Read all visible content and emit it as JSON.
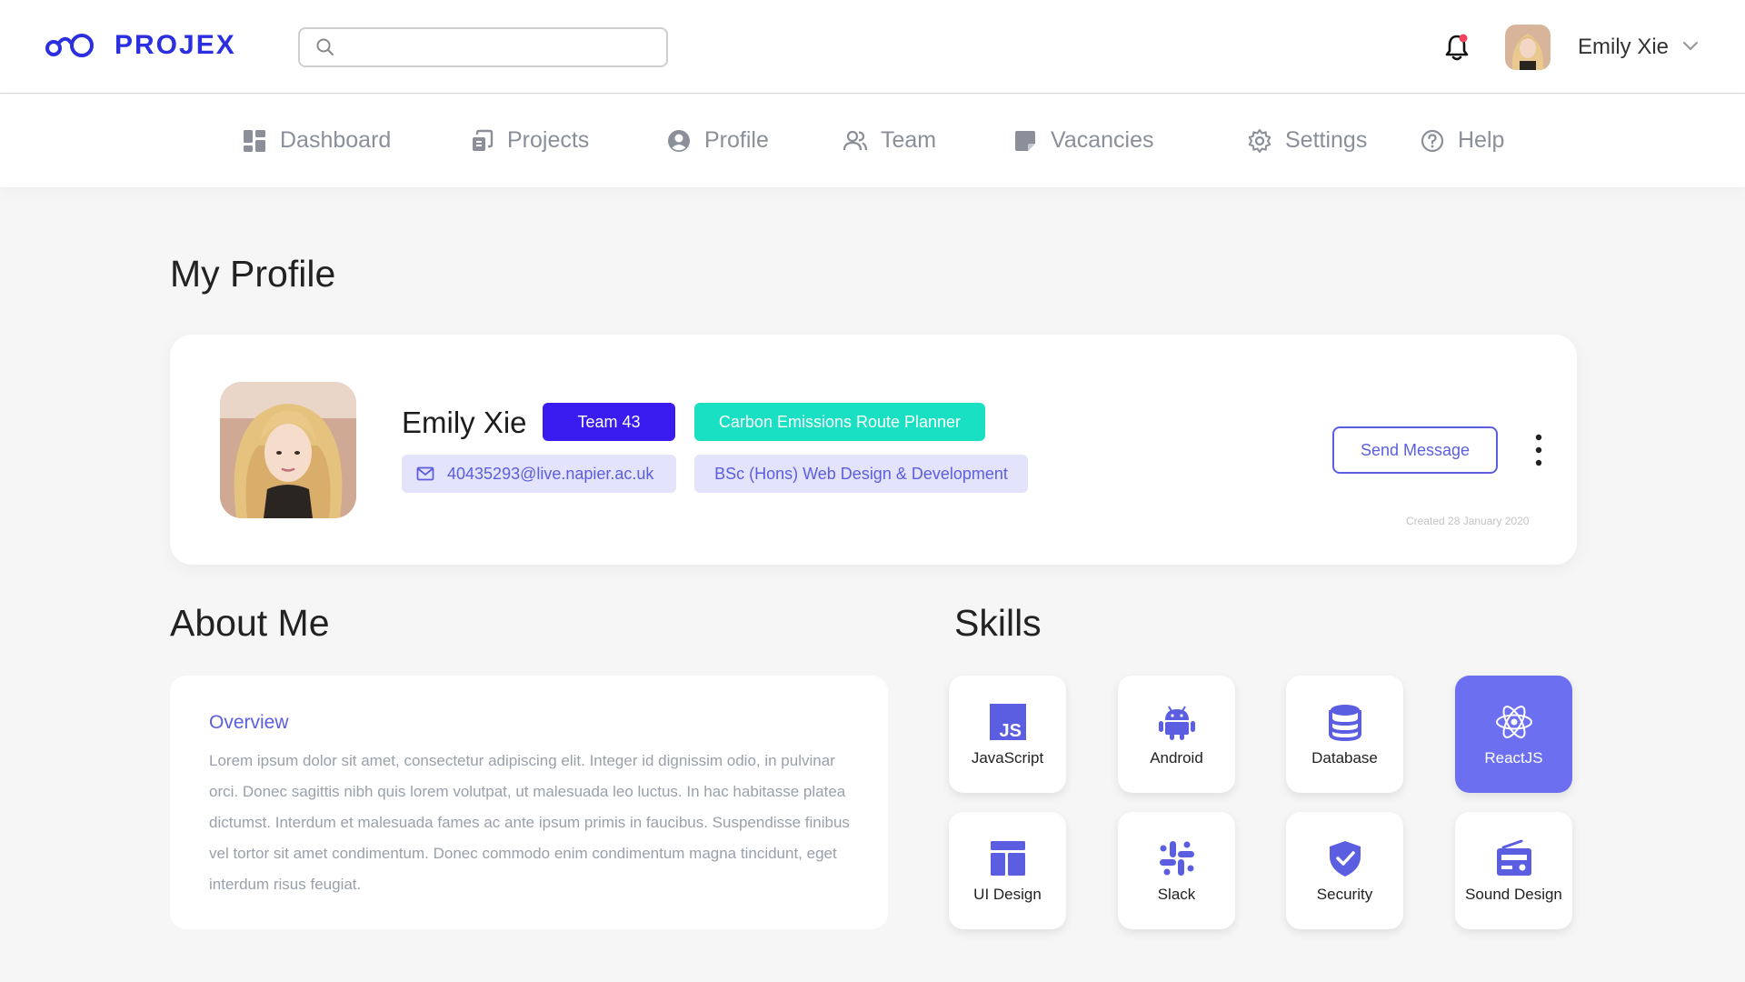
{
  "brand": {
    "name": "PROJEX",
    "color": "#2b2fe0"
  },
  "search": {
    "placeholder": "",
    "icon": "search-icon"
  },
  "user": {
    "name": "Emily Xie",
    "has_notification": true
  },
  "nav": {
    "items": [
      {
        "label": "Dashboard",
        "icon": "dashboard-icon"
      },
      {
        "label": "Projects",
        "icon": "projects-icon"
      },
      {
        "label": "Profile",
        "icon": "profile-icon"
      },
      {
        "label": "Team",
        "icon": "team-icon"
      },
      {
        "label": "Vacancies",
        "icon": "vacancies-icon"
      },
      {
        "label": "Settings",
        "icon": "settings-icon"
      },
      {
        "label": "Help",
        "icon": "help-icon"
      }
    ]
  },
  "page": {
    "title": "My Profile"
  },
  "profile": {
    "name": "Emily Xie",
    "team": "Team 43",
    "project": "Carbon Emissions Route Planner",
    "email": "40435293@live.napier.ac.uk",
    "degree": "BSc (Hons) Web Design & Development",
    "send_message": "Send Message",
    "created": "Created 28 January 2020"
  },
  "about": {
    "heading": "About Me",
    "title": "Overview",
    "text": "Lorem ipsum dolor sit amet, consectetur adipiscing elit. Integer id dignissim odio, in pulvinar orci. Donec sagittis nibh quis lorem volutpat, ut malesuada leo luctus. In hac habitasse platea dictumst. Interdum et malesuada fames ac ante ipsum primis in faucibus. Suspendisse finibus vel tortor sit amet condimentum. Donec commodo enim condimentum magna tincidunt, eget interdum risus feugiat."
  },
  "skills": {
    "heading": "Skills",
    "items": [
      {
        "label": "JavaScript",
        "icon": "javascript-icon",
        "active": false
      },
      {
        "label": "Android",
        "icon": "android-icon",
        "active": false
      },
      {
        "label": "Database",
        "icon": "database-icon",
        "active": false
      },
      {
        "label": "ReactJS",
        "icon": "react-icon",
        "active": true
      },
      {
        "label": "UI Design",
        "icon": "ui-design-icon",
        "active": false
      },
      {
        "label": "Slack",
        "icon": "slack-icon",
        "active": false
      },
      {
        "label": "Security",
        "icon": "shield-icon",
        "active": false
      },
      {
        "label": "Sound Design",
        "icon": "radio-icon",
        "active": false
      }
    ]
  },
  "colors": {
    "accent": "#5b5ee0",
    "team_pill": "#3b1cf0",
    "project_pill": "#19e0c2",
    "active_skill": "#6b6ff0",
    "notification": "#f0445c"
  }
}
